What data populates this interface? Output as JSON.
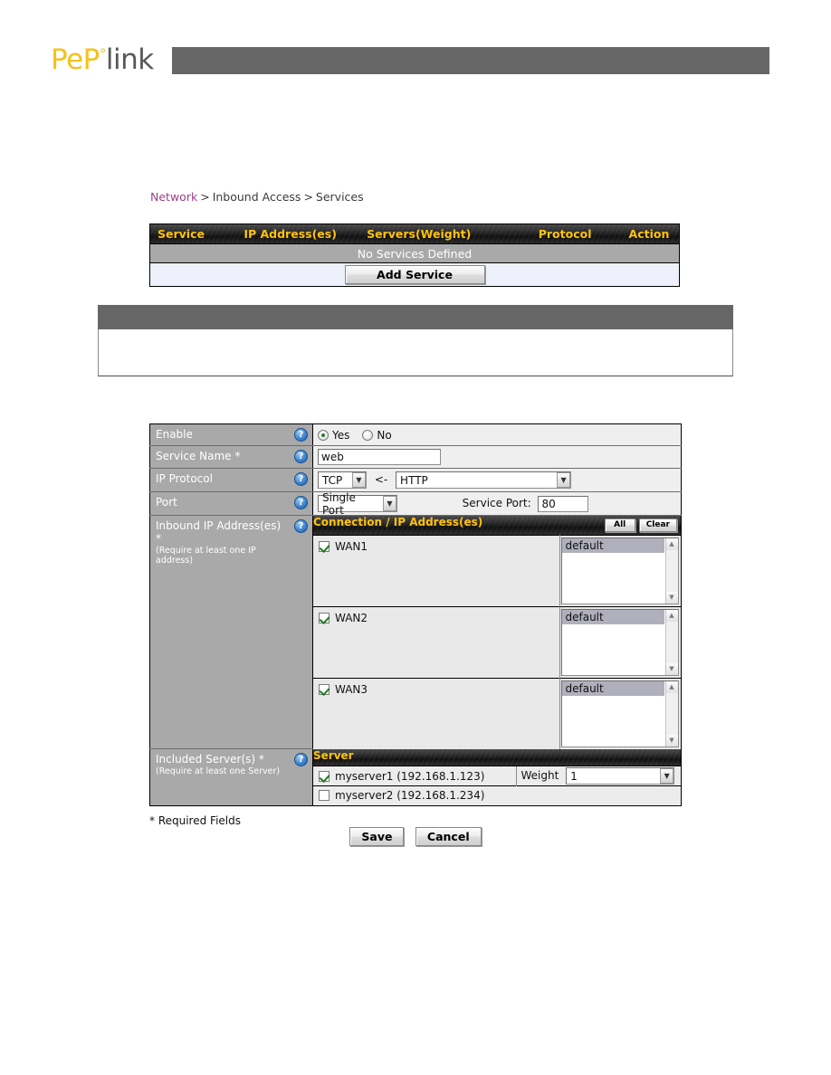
{
  "brand": {
    "pep": "PeP",
    "sup": "°",
    "link": "link"
  },
  "breadcrumb": {
    "root": "Network",
    "sep1": ">",
    "level2": "Inbound Access",
    "sep2": ">",
    "level3": "Services"
  },
  "services_table": {
    "columns": [
      "Service",
      "IP Address(es)",
      "Servers(Weight)",
      "Protocol",
      "Action"
    ],
    "empty_message": "No Services Defined",
    "add_button": "Add Service"
  },
  "form": {
    "enable": {
      "label": "Enable",
      "help": "?",
      "options": [
        {
          "label": "Yes",
          "selected": true
        },
        {
          "label": "No",
          "selected": false
        }
      ]
    },
    "service_name": {
      "label": "Service Name *",
      "help": "?",
      "value": "web"
    },
    "ip_protocol": {
      "label": "IP Protocol",
      "help": "?",
      "protocol_value": "TCP",
      "separator": "<-",
      "app_value": "HTTP"
    },
    "port": {
      "label": "Port",
      "help": "?",
      "mode_value": "Single Port",
      "service_port_label": "Service Port:",
      "service_port_value": "80"
    },
    "inbound": {
      "label": "Inbound IP Address(es) *",
      "sublabel": "(Require at least one IP address)",
      "help": "?",
      "section_title": "Connection / IP Address(es)",
      "all_button": "All",
      "clear_button": "Clear",
      "connections": [
        {
          "name": "WAN1",
          "checked": true,
          "selected_address": "default"
        },
        {
          "name": "WAN2",
          "checked": true,
          "selected_address": "default"
        },
        {
          "name": "WAN3",
          "checked": true,
          "selected_address": "default"
        }
      ]
    },
    "servers": {
      "label": "Included Server(s) *",
      "sublabel": "(Require at least one Server)",
      "help": "?",
      "section_title": "Server",
      "weight_label": "Weight",
      "rows": [
        {
          "name": "myserver1 (192.168.1.123)",
          "checked": true,
          "weight": "1"
        },
        {
          "name": "myserver2 (192.168.1.234)",
          "checked": false,
          "weight": ""
        }
      ]
    }
  },
  "footer": {
    "required_note": "* Required Fields",
    "save": "Save",
    "cancel": "Cancel"
  },
  "colors": {
    "brand_yellow": "#f5c21b",
    "header_gray": "#666666",
    "table_header_text": "#ffc20e",
    "label_bg": "#a9a9a9",
    "breadcrumb_link": "#9c3f8c"
  }
}
